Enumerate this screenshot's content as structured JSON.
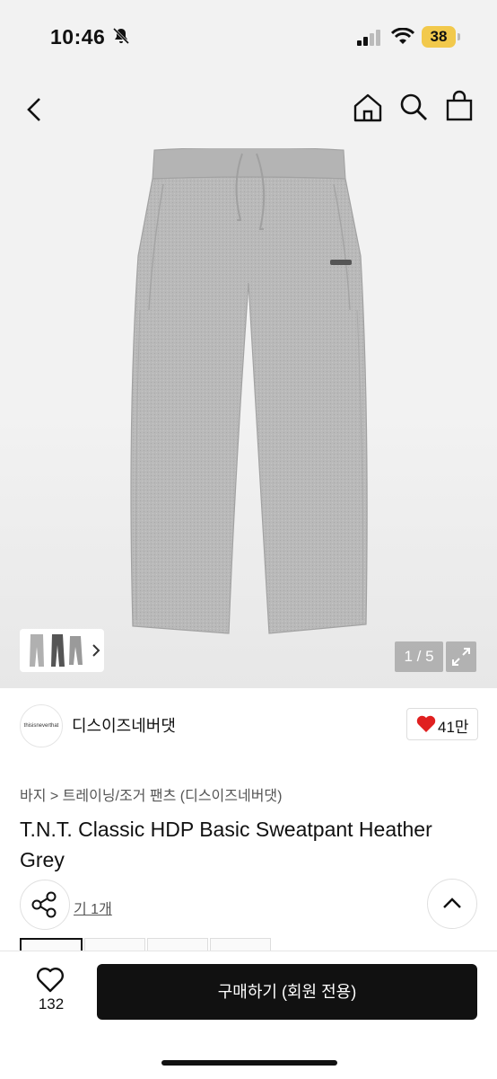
{
  "status": {
    "time": "10:46",
    "battery": "38"
  },
  "gallery": {
    "counter": "1 / 5"
  },
  "shop": {
    "name": "디스이즈네버댓",
    "logo_text": "thisisneverthat",
    "likes": "41만"
  },
  "product": {
    "breadcrumb": "바지 > 트레이닝/조거 팬츠 (디스이즈네버댓)",
    "title": "T.N.T. Classic HDP Basic Sweatpant Heather Grey",
    "review_link": "기 1개"
  },
  "bottom": {
    "wish_count": "132",
    "buy_label": "구매하기 (회원 전용)"
  },
  "colors": {
    "accent": "#111111",
    "heart": "#e02020",
    "battery": "#f2c94c"
  }
}
